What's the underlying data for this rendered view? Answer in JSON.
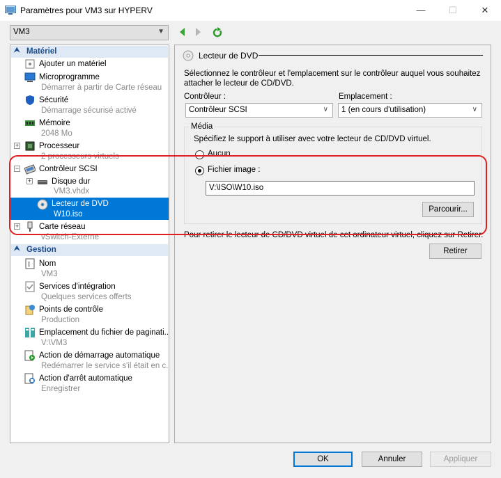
{
  "window": {
    "title": "Paramètres pour VM3 sur HYPERV",
    "minimize": "—",
    "maximize": "☐",
    "close": "✕"
  },
  "toolbar": {
    "vm_selected": "VM3"
  },
  "tree": {
    "materiel_header": "Matériel",
    "gestion_header": "Gestion",
    "items": [
      {
        "label": "Ajouter un matériel",
        "sub": ""
      },
      {
        "label": "Microprogramme",
        "sub": "Démarrer à partir de Carte réseau"
      },
      {
        "label": "Sécurité",
        "sub": "Démarrage sécurisé activé"
      },
      {
        "label": "Mémoire",
        "sub": "2048 Mo"
      },
      {
        "label": "Processeur",
        "sub": "2 processeurs virtuels"
      },
      {
        "label": "Contrôleur SCSI",
        "sub": ""
      },
      {
        "label": "Disque dur",
        "sub": "VM3.vhdx"
      },
      {
        "label": "Lecteur de DVD",
        "sub": "W10.iso"
      },
      {
        "label": "Carte réseau",
        "sub": "vSwitch-Externe"
      }
    ],
    "gestion_items": [
      {
        "label": "Nom",
        "sub": "VM3"
      },
      {
        "label": "Services d'intégration",
        "sub": "Quelques services offerts"
      },
      {
        "label": "Points de contrôle",
        "sub": "Production"
      },
      {
        "label": "Emplacement du fichier de paginati...",
        "sub": "V:\\VM3"
      },
      {
        "label": "Action de démarrage automatique",
        "sub": "Redémarrer le service s'il était en c..."
      },
      {
        "label": "Action d'arrêt automatique",
        "sub": "Enregistrer"
      }
    ]
  },
  "panel": {
    "title": "Lecteur de DVD",
    "description": "Sélectionnez le contrôleur et l'emplacement sur le contrôleur auquel vous souhaitez attacher le lecteur de CD/DVD.",
    "controller_label": "Contrôleur :",
    "controller_value": "Contrôleur SCSI",
    "location_label": "Emplacement :",
    "location_value": "1 (en cours d'utilisation)",
    "media_group": "Média",
    "media_desc": "Spécifiez le support à utiliser avec votre lecteur de CD/DVD virtuel.",
    "option_none": "Aucun",
    "option_image": "Fichier image :",
    "image_path": "V:\\ISO\\W10.iso",
    "browse": "Parcourir...",
    "remove_desc": "Pour retirer le lecteur de CD/DVD virtuel de cet ordinateur virtuel, cliquez sur Retirer.",
    "remove": "Retirer"
  },
  "footer": {
    "ok": "OK",
    "cancel": "Annuler",
    "apply": "Appliquer"
  },
  "colors": {
    "selection": "#0078d7",
    "highlight_box": "#e02020",
    "section_header": "#dfe8f5"
  }
}
